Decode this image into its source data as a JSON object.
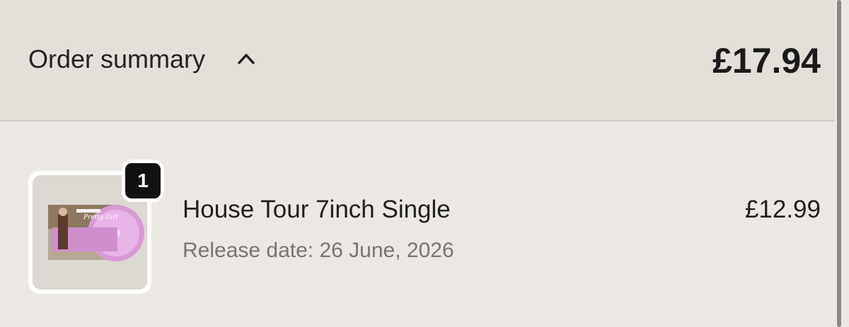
{
  "order_summary": {
    "label": "Order summary",
    "toggle_icon": "chevron-up-icon",
    "total": "£17.94"
  },
  "items": [
    {
      "quantity": "1",
      "name": "House Tour 7inch Single",
      "meta": "Release date: 26 June, 2026",
      "price": "£12.99",
      "image_name": "product-thumbnail",
      "image_text": "Pretty Girl"
    }
  ],
  "colors": {
    "background": "#ebe7e2",
    "header_background": "#e4dfd9",
    "badge": "#111111",
    "muted_text": "#777571"
  }
}
